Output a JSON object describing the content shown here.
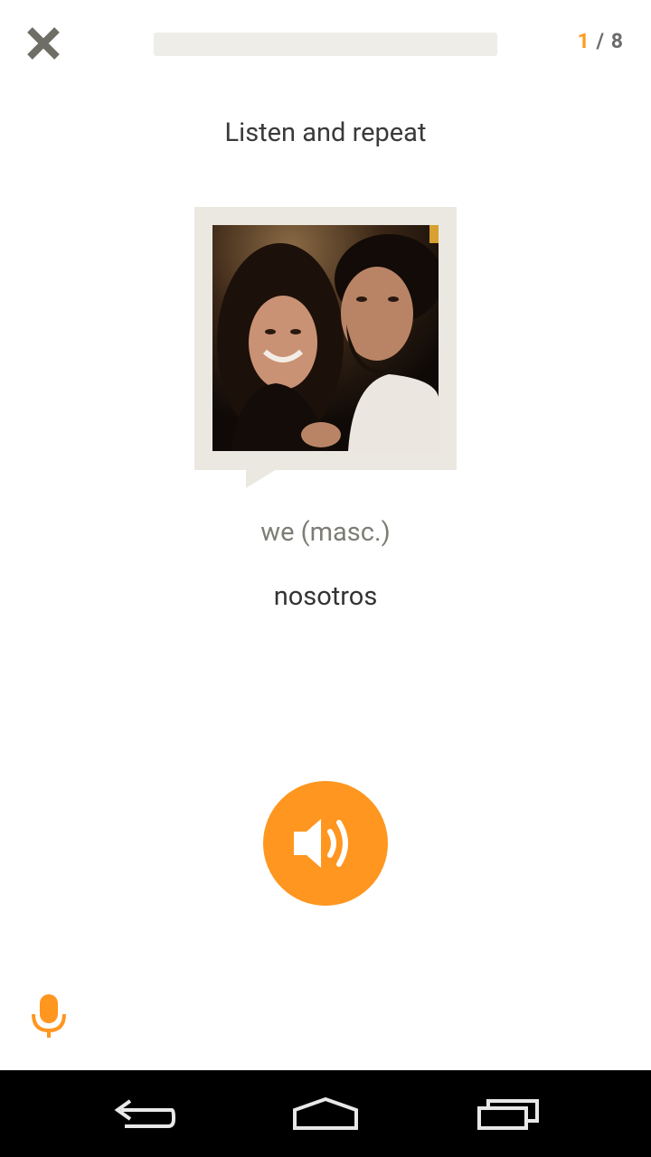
{
  "header": {
    "close_icon": "close-icon",
    "progress": {
      "current": 1,
      "total": 8,
      "fraction": 0
    },
    "counter": {
      "current": "1",
      "separator": " / ",
      "total": "8"
    }
  },
  "lesson": {
    "instruction": "Listen and repeat",
    "image_description": "photo-of-couple",
    "translation": "we (masc.)",
    "word": "nosotros"
  },
  "controls": {
    "play_audio_icon": "speaker-icon",
    "microphone_icon": "microphone-icon"
  },
  "system_nav": {
    "back_icon": "back-icon",
    "home_icon": "home-icon",
    "recents_icon": "recent-apps-icon"
  },
  "colors": {
    "accent": "#ff961f",
    "progress_track": "#efede8",
    "frame": "#ebe8e1",
    "text_dark": "#333333",
    "text_muted": "#7e7d75"
  }
}
